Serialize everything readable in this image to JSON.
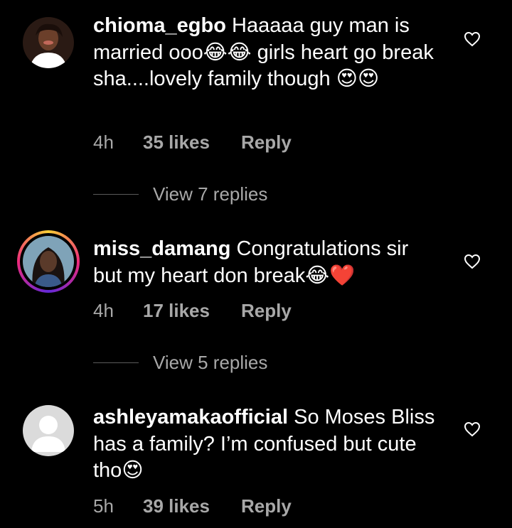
{
  "comments": [
    {
      "username": "chioma_egbo",
      "text_parts": [
        "Haaaaa guy man is married ooo",
        "😂😂",
        " girls heart go break sha....lovely family though ",
        "😍😍"
      ],
      "time": "4h",
      "likes": "35 likes",
      "reply": "Reply",
      "view_replies": "View 7 replies"
    },
    {
      "username": "miss_damang",
      "text_parts": [
        "Congratulations sir but my heart don break",
        "😂❤️"
      ],
      "time": "4h",
      "likes": "17 likes",
      "reply": "Reply",
      "view_replies": "View 5 replies"
    },
    {
      "username": "ashleyamakaofficial",
      "text_parts": [
        "So Moses Bliss has a family? I’m confused but cute tho",
        "😍"
      ],
      "time": "5h",
      "likes": "39 likes",
      "reply": "Reply"
    }
  ],
  "icons": {
    "like": "heart-outline-icon"
  },
  "colors": {
    "background": "#000000",
    "text": "#ffffff",
    "secondary": "#a8a8a8",
    "story_ring": [
      "#f9ce34",
      "#ee2a7b",
      "#6228d7"
    ]
  }
}
